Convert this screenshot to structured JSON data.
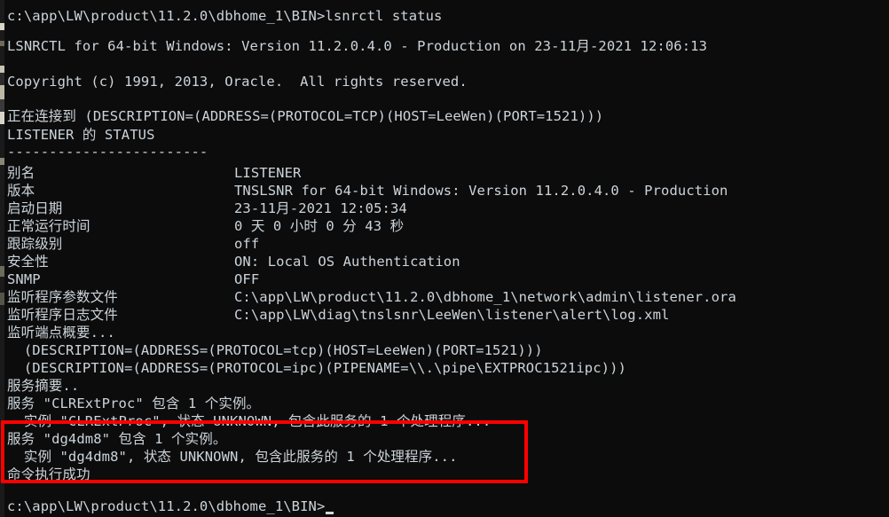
{
  "window": {
    "title": "lsnrctl status",
    "background_color": "#0c0c0c",
    "text_color": "#ccd4da",
    "annotation_color": "#fe0000"
  },
  "prompt": {
    "top_prompt": "c:\\app\\LW\\product\\11.2.0\\dbhome_1\\BIN>lsnrctl status",
    "bottom_prompt": "c:\\app\\LW\\product\\11.2.0\\dbhome_1\\BIN>"
  },
  "banner": {
    "version_line": "LSNRCTL for 64-bit Windows: Version 11.2.0.4.0 - Production on 23-11月-2021 12:06:13",
    "copyright_line": "Copyright (c) 1991, 2013, Oracle.  All rights reserved."
  },
  "connect": {
    "connecting_line": "正在连接到 (DESCRIPTION=(ADDRESS=(PROTOCOL=TCP)(HOST=LeeWen)(PORT=1521)))",
    "status_header": "LISTENER 的 STATUS",
    "separator": "------------------------"
  },
  "status_table": [
    {
      "label": "别名",
      "value": "LISTENER"
    },
    {
      "label": "版本",
      "value": "TNSLSNR for 64-bit Windows: Version 11.2.0.4.0 - Production"
    },
    {
      "label": "启动日期",
      "value": "23-11月-2021 12:05:34"
    },
    {
      "label": "正常运行时间",
      "value": "0 天 0 小时 0 分 43 秒"
    },
    {
      "label": "跟踪级别",
      "value": "off"
    },
    {
      "label": "安全性",
      "value": "ON: Local OS Authentication"
    },
    {
      "label": "SNMP",
      "value": "OFF"
    },
    {
      "label": "监听程序参数文件",
      "value": "C:\\app\\LW\\product\\11.2.0\\dbhome_1\\network\\admin\\listener.ora"
    },
    {
      "label": "监听程序日志文件",
      "value": "C:\\app\\LW\\diag\\tnslsnr\\LeeWen\\listener\\alert\\log.xml"
    }
  ],
  "endpoints": {
    "heading": "监听端点概要...",
    "entries": [
      "  (DESCRIPTION=(ADDRESS=(PROTOCOL=tcp)(HOST=LeeWen)(PORT=1521)))",
      "  (DESCRIPTION=(ADDRESS=(PROTOCOL=ipc)(PIPENAME=\\\\.\\pipe\\EXTPROC1521ipc)))"
    ]
  },
  "services": {
    "heading": "服务摘要..",
    "entries": [
      "服务 \"CLRExtProc\" 包含 1 个实例。",
      "  实例 \"CLRExtProc\", 状态 UNKNOWN, 包含此服务的 1 个处理程序...",
      "服务 \"dg4dm8\" 包含 1 个实例。",
      "  实例 \"dg4dm8\", 状态 UNKNOWN, 包含此服务的 1 个处理程序..."
    ],
    "result": "命令执行成功"
  },
  "annotation": {
    "name": "red-highlight-box",
    "covers": "服务 \"dg4dm8\" 包含 1 个实例。 / 实例 \"dg4dm8\", 状态 UNKNOWN, 包含此服务的 1 个处理程序... / 命令执行成功"
  }
}
